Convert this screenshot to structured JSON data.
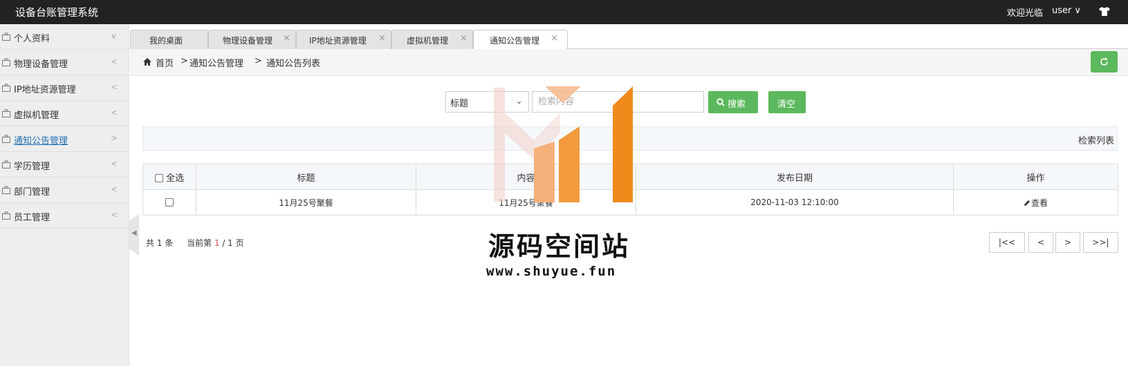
{
  "header": {
    "title": "设备台账管理系统",
    "welcome": "欢迎光临",
    "user": "user",
    "user_caret": "∨",
    "skin_icon": "tshirt-icon"
  },
  "sidebar": {
    "items": [
      {
        "label": "个人资料",
        "chevron": "∨",
        "active": false
      },
      {
        "label": "物理设备管理",
        "chevron": "<",
        "active": false
      },
      {
        "label": "IP地址资源管理",
        "chevron": "<",
        "active": false
      },
      {
        "label": "虚拟机管理",
        "chevron": "<",
        "active": false
      },
      {
        "label": "通知公告管理",
        "chevron": ">",
        "active": true
      },
      {
        "label": "学历管理",
        "chevron": "<",
        "active": false
      },
      {
        "label": "部门管理",
        "chevron": "<",
        "active": false
      },
      {
        "label": "员工管理",
        "chevron": "<",
        "active": false
      }
    ],
    "toggle": "◀"
  },
  "tabs": [
    {
      "label": "我的桌面",
      "closable": false,
      "active": false
    },
    {
      "label": "物理设备管理",
      "close": "×",
      "active": false
    },
    {
      "label": "IP地址资源管理",
      "close": "×",
      "active": false
    },
    {
      "label": "虚拟机管理",
      "close": "×",
      "active": false
    },
    {
      "label": "通知公告管理",
      "close": "×",
      "active": true
    }
  ],
  "breadcrumb": {
    "home": "首页",
    "sep": ">",
    "level1": "通知公告管理",
    "level2": "通知公告列表"
  },
  "search": {
    "field_selected": "标题",
    "field_caret": "⌄",
    "placeholder": "检索内容",
    "search_label": "搜索",
    "clear_label": "清空"
  },
  "list_header": "检索列表",
  "table": {
    "select_all": "全选",
    "columns": [
      "标题",
      "内容",
      "发布日期",
      "操作"
    ],
    "rows": [
      {
        "title": "11月25号聚餐",
        "content": "11月25号聚餐",
        "date": "2020-11-03 12:10:00",
        "action": "查看"
      }
    ]
  },
  "pagination": {
    "total_prefix": "共",
    "total": "1",
    "total_suffix": "条",
    "current_prefix": "当前第",
    "current": "1",
    "pages": "/ 1",
    "pages_suffix": "页",
    "first": "|<<",
    "prev": "<",
    "next": ">",
    "last": ">>|"
  },
  "watermark": {
    "title": "源码空间站",
    "url": "www.shuyue.fun"
  },
  "colors": {
    "header_bg": "#222222",
    "green": "#5cb85c",
    "accent_link": "#1e6fb3",
    "logo_orange": "#f08a1c"
  }
}
